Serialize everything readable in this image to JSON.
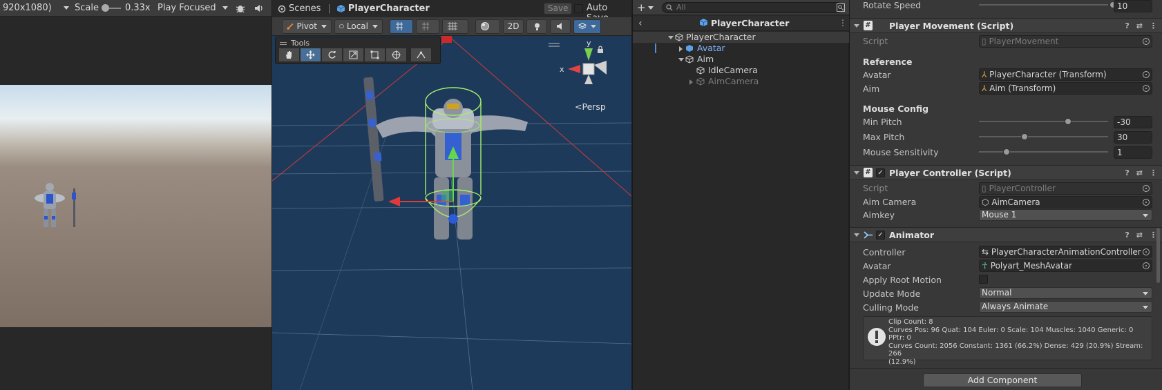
{
  "game_view": {
    "resolution": "920x1080)",
    "scale_label": "Scale",
    "scale_value": "0.33x",
    "play_mode": "Play Focused"
  },
  "scene_view": {
    "tab_scenes": "Scenes",
    "tab_object": "PlayerCharacter",
    "save_label": "Save",
    "auto_save_label": "Auto Save",
    "pivot_label": "Pivot",
    "local_label": "Local",
    "mode_2d": "2D",
    "tools_title": "Tools",
    "gizmo_y": "y",
    "gizmo_x": "x",
    "persp_label": "Persp"
  },
  "hierarchy": {
    "search_placeholder": "All",
    "scene_title": "PlayerCharacter",
    "items": [
      {
        "label": "PlayerCharacter"
      },
      {
        "label": "Avatar"
      },
      {
        "label": "Aim"
      },
      {
        "label": "IdleCamera"
      },
      {
        "label": "AimCamera"
      }
    ]
  },
  "inspector": {
    "rotate_speed_label": "Rotate Speed",
    "rotate_speed_value": "10",
    "player_movement": {
      "title": "Player Movement (Script)",
      "script_label": "Script",
      "script_value": "PlayerMovement",
      "reference_header": "Reference",
      "avatar_label": "Avatar",
      "avatar_value": "PlayerCharacter (Transform)",
      "aim_label": "Aim",
      "aim_value": "Aim (Transform)",
      "mouse_config_header": "Mouse Config",
      "min_pitch_label": "Min Pitch",
      "min_pitch_value": "-30",
      "max_pitch_label": "Max Pitch",
      "max_pitch_value": "30",
      "sensitivity_label": "Mouse Sensitivity",
      "sensitivity_value": "1"
    },
    "player_controller": {
      "title": "Player Controller (Script)",
      "script_label": "Script",
      "script_value": "PlayerController",
      "aim_camera_label": "Aim Camera",
      "aim_camera_value": "AimCamera",
      "aimkey_label": "Aimkey",
      "aimkey_value": "Mouse 1"
    },
    "animator": {
      "title": "Animator",
      "controller_label": "Controller",
      "controller_value": "PlayerCharacterAnimationController",
      "avatar_label": "Avatar",
      "avatar_value": "Polyart_MeshAvatar",
      "apply_root_motion_label": "Apply Root Motion",
      "update_mode_label": "Update Mode",
      "update_mode_value": "Normal",
      "culling_mode_label": "Culling Mode",
      "culling_mode_value": "Always Animate",
      "info_line1": "Clip Count: 8",
      "info_line2": "Curves Pos: 96 Quat: 104 Euler: 0 Scale: 104 Muscles: 1040 Generic: 0 PPtr: 0",
      "info_line3": "Curves Count: 2056 Constant: 1361 (66.2%) Dense: 429 (20.9%) Stream: 266",
      "info_line4": "(12.9%)"
    },
    "add_component_label": "Add Component"
  },
  "colors": {
    "accent_blue": "#3d6a9a",
    "scene_background": "#1e3a5a",
    "selection_blue": "#7fb6ff"
  }
}
